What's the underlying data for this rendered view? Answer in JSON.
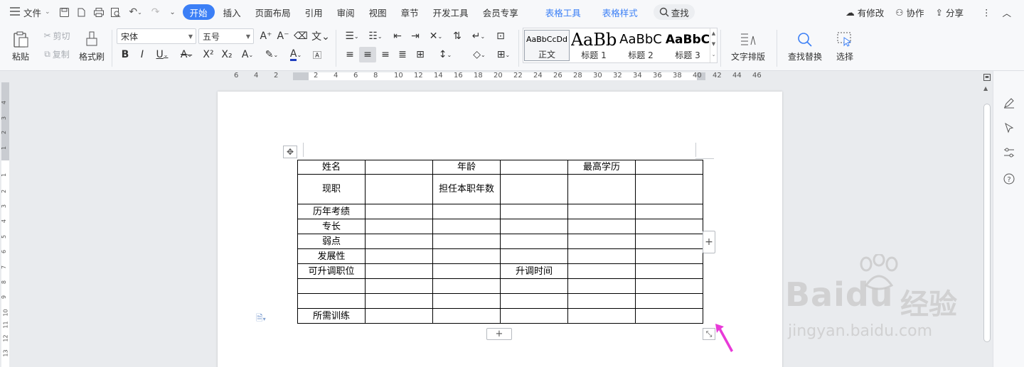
{
  "menubar": {
    "file_label": "文件",
    "tabs": [
      {
        "label": "开始",
        "active": true
      },
      {
        "label": "插入"
      },
      {
        "label": "页面布局"
      },
      {
        "label": "引用"
      },
      {
        "label": "审阅"
      },
      {
        "label": "视图"
      },
      {
        "label": "章节"
      },
      {
        "label": "开发工具"
      },
      {
        "label": "会员专享"
      }
    ],
    "context_tabs": [
      "表格工具",
      "表格样式"
    ],
    "search_label": "查找",
    "right": {
      "modified": "有修改",
      "collab": "协作",
      "share": "分享"
    }
  },
  "ribbon": {
    "paste": "粘贴",
    "cut": "剪切",
    "copy": "复制",
    "format_painter": "格式刷",
    "font_name": "宋体",
    "font_size": "五号",
    "styles": [
      {
        "preview": "AaBbCcDd",
        "name": "正文",
        "selected": true
      },
      {
        "preview": "AaBb",
        "name": "标题 1"
      },
      {
        "preview": "AaBbC",
        "name": "标题 2"
      },
      {
        "preview": "AaBbC",
        "name": "标题 3"
      }
    ],
    "text_layout": "文字排版",
    "find_replace": "查找替换",
    "select": "选择"
  },
  "ruler": {
    "h_labels": [
      "6",
      "4",
      "2",
      "2",
      "4",
      "6",
      "8",
      "10",
      "12",
      "14",
      "16",
      "18",
      "20",
      "22",
      "24",
      "26",
      "28",
      "30",
      "32",
      "34",
      "36",
      "38",
      "40",
      "42",
      "44",
      "46"
    ],
    "v_labels": [
      "4",
      "3",
      "2",
      "1",
      "1",
      "2",
      "3",
      "4",
      "5",
      "6",
      "7",
      "8",
      "9",
      "10",
      "11",
      "12",
      "13"
    ]
  },
  "table": {
    "rows": [
      [
        "姓名",
        "",
        "年龄",
        "",
        "最高学历",
        ""
      ],
      [
        "现职",
        "",
        "担任本职年数",
        "",
        "",
        ""
      ],
      [
        "历年考绩",
        "",
        "",
        "",
        "",
        ""
      ],
      [
        "专长",
        "",
        "",
        "",
        "",
        ""
      ],
      [
        "弱点",
        "",
        "",
        "",
        "",
        ""
      ],
      [
        "发展性",
        "",
        "",
        "",
        "",
        ""
      ],
      [
        "可升调职位",
        "",
        "",
        "升调时间",
        "",
        ""
      ],
      [
        "",
        "",
        "",
        "",
        "",
        ""
      ],
      [
        "",
        "",
        "",
        "",
        "",
        ""
      ],
      [
        "所需训练",
        "",
        "",
        "",
        "",
        ""
      ]
    ]
  },
  "watermark": {
    "brand": "Baidu",
    "cn": "经验",
    "url": "jingyan.baidu.com"
  },
  "colors": {
    "accent": "#3b7ff6",
    "arrow": "#e83ad8",
    "bg": "#e9ebee"
  }
}
